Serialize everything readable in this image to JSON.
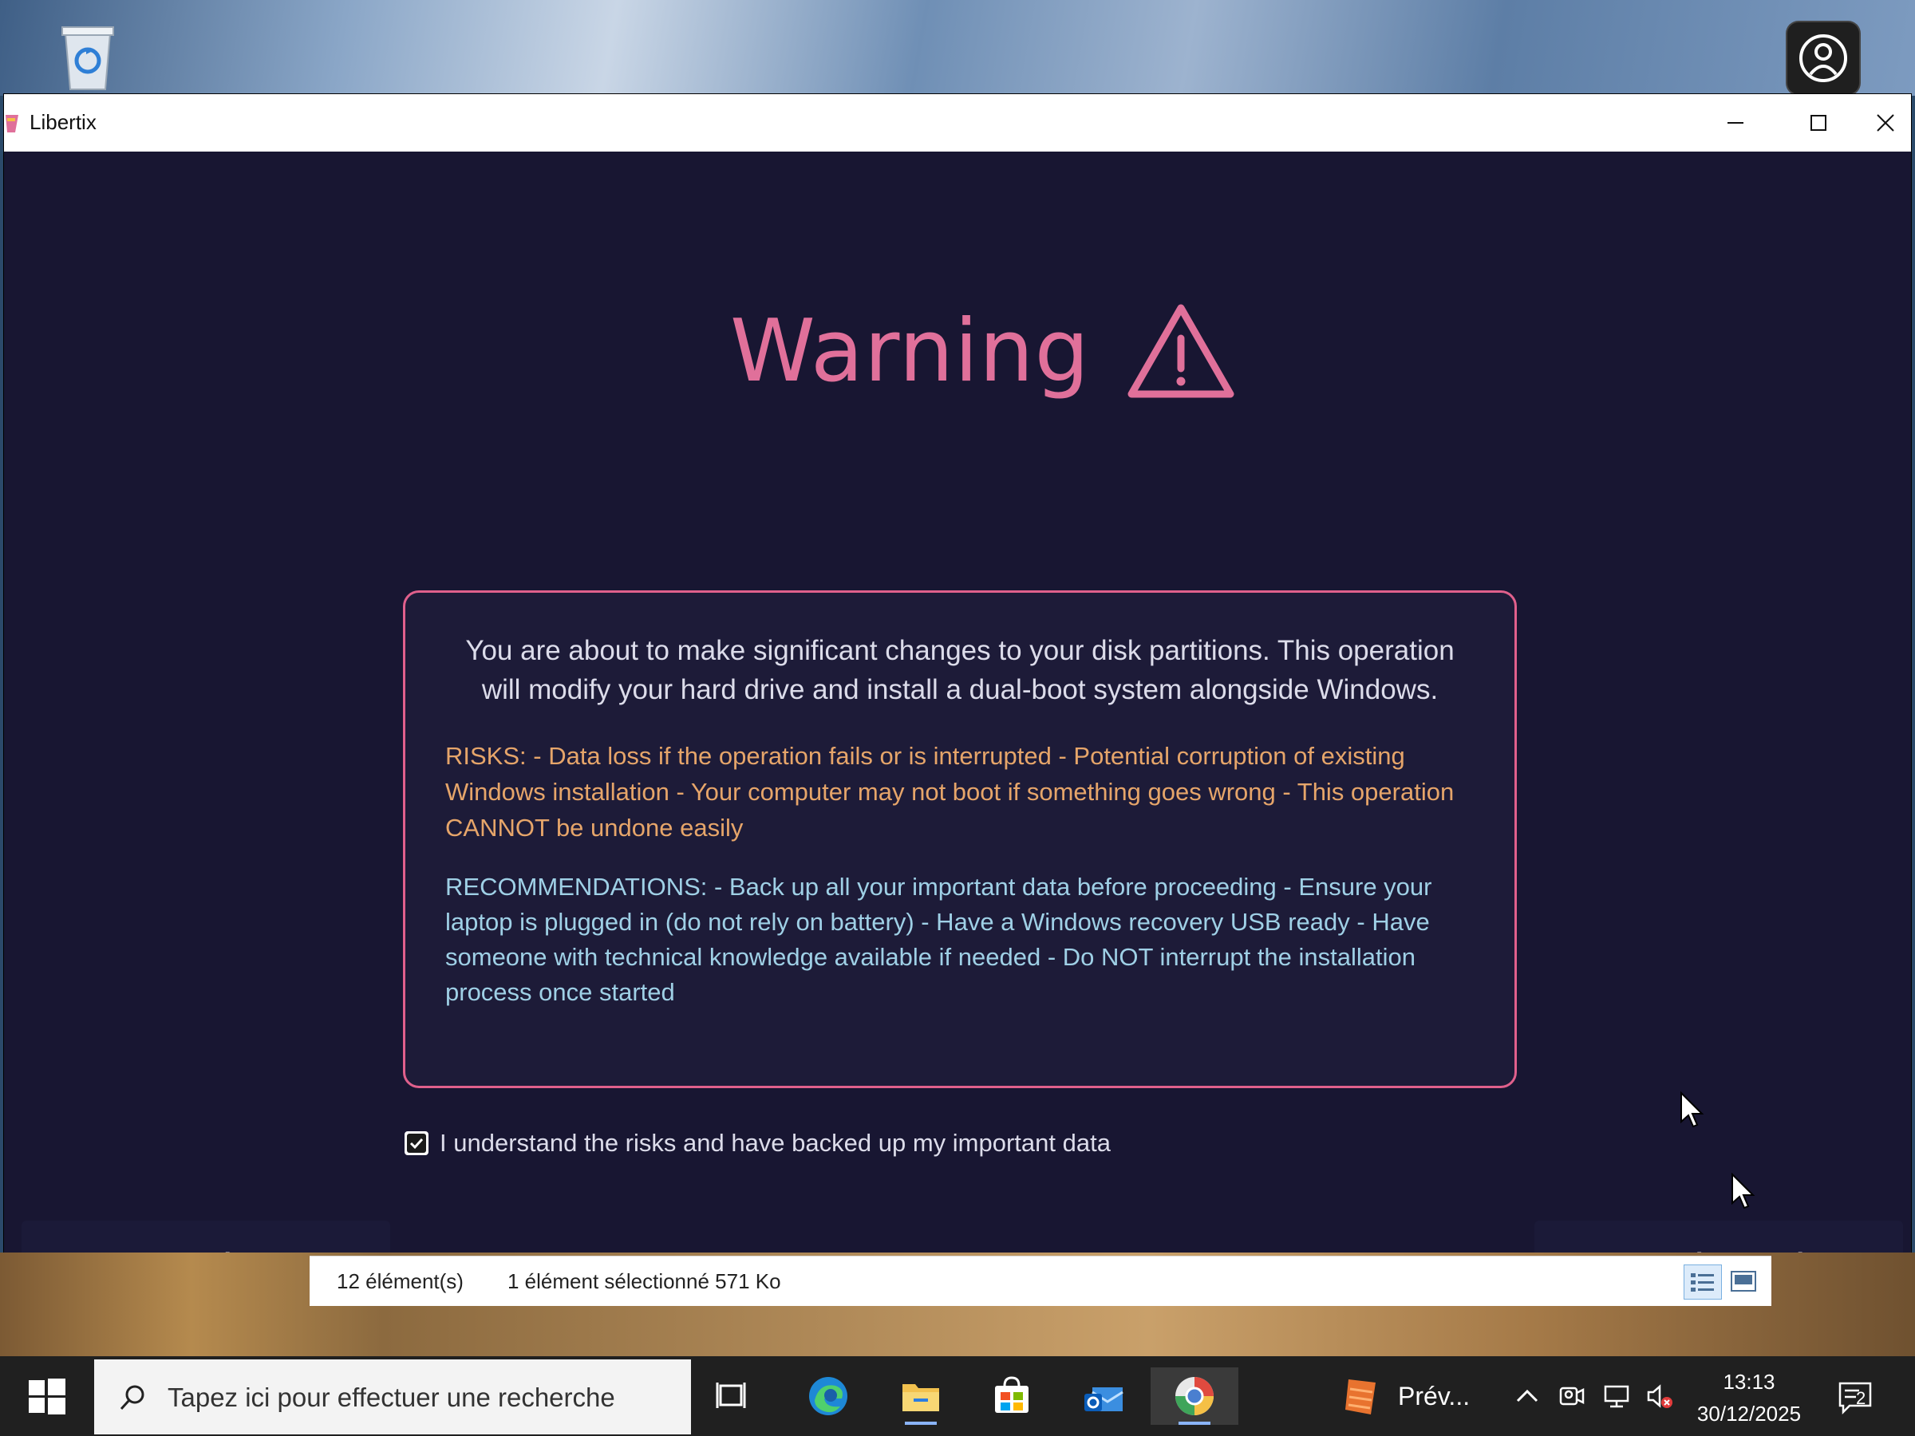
{
  "window": {
    "title": "Libertix"
  },
  "warning": {
    "title": "Warning",
    "intro": "You are about to make significant changes to your disk partitions. This operation will modify your hard drive and install a dual-boot system alongside Windows.",
    "risks": "RISKS: - Data loss if the operation fails or is interrupted - Potential corruption of existing Windows installation - Your computer may not boot if something goes wrong - This operation CANNOT be undone easily",
    "recommendations": "RECOMMENDATIONS: - Back up all your important data before proceeding - Ensure your laptop is plugged in (do not rely on battery) - Have a Windows recovery USB ready - Have someone with technical knowledge available if needed - Do NOT interrupt the installation process once started"
  },
  "consent": {
    "label": "I understand the risks and have backed up my important data",
    "checked": true
  },
  "buttons": {
    "back": "Back",
    "understand": "I Understand"
  },
  "explorer_status": {
    "item_count": "12 élément(s)",
    "selected": "1 élément sélectionné  571 Ko"
  },
  "taskbar": {
    "search_placeholder": "Tapez ici pour effectuer une recherche",
    "preview_app_label": "Prév...",
    "time": "13:13",
    "date": "30/12/2025",
    "notification_count": "2"
  },
  "colors": {
    "accent": "#e0709a",
    "risk_text": "#e6a56a",
    "recommendation_text": "#9fd0e6",
    "window_bg": "#181632"
  },
  "icons": {
    "app": "libertix-icon",
    "warning": "warning-triangle-icon",
    "desktop": [
      "recycle-bin-icon",
      "user-account-icon"
    ],
    "taskbar": [
      "windows-start-icon",
      "search-icon",
      "task-view-icon",
      "edge-icon",
      "file-explorer-icon",
      "store-icon",
      "outlook-icon",
      "libertix-taskbar-icon",
      "preview-app-icon"
    ],
    "tray": [
      "chevron-up-icon",
      "meet-now-icon",
      "network-icon",
      "volume-muted-icon",
      "notification-icon"
    ]
  }
}
